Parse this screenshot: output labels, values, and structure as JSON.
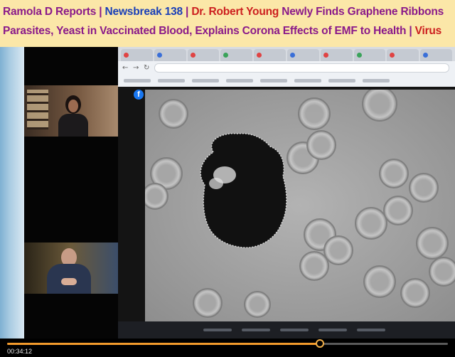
{
  "headline": {
    "line1": [
      {
        "text": "Ramola D Reports",
        "tone": "purple"
      },
      {
        "text": " | ",
        "tone": "sep"
      },
      {
        "text": "Newsbreak 138",
        "tone": "blue"
      },
      {
        "text": " | ",
        "tone": "sep"
      },
      {
        "text": "Dr. Robert Young",
        "tone": "red"
      },
      {
        "text": " Newly Finds Graphene Ribbons",
        "tone": "purple"
      }
    ],
    "line2": [
      {
        "text": "Parasites, Yeast in Vaccinated Blood, Explains Corona Effects of EMF to Health",
        "tone": "purple"
      },
      {
        "text": " | ",
        "tone": "sep"
      },
      {
        "text": "Virus",
        "tone": "red"
      }
    ]
  },
  "screen_share": {
    "facebook_icon": "facebook-icon"
  },
  "player": {
    "timestamp": "00:34:12",
    "progress": 0.71,
    "accent": "#f39b2c"
  },
  "colors": {
    "banner_bg": "#fbe7a8",
    "purple": "#8a1a8a",
    "red": "#cc1f1f",
    "blue": "#1a3fb8"
  }
}
